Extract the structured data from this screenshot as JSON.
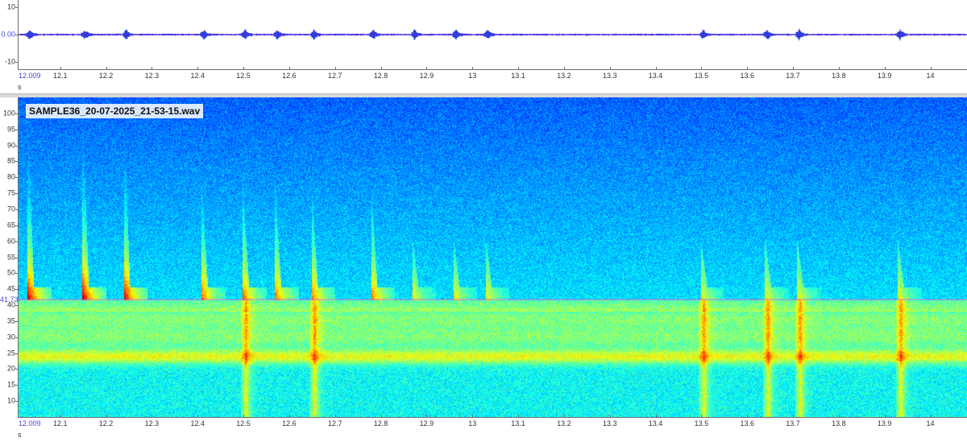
{
  "file_name": "SAMPLE36_20-07-2025_21-53-15.wav",
  "waveform": {
    "y_ticks": [
      "10",
      "0.00",
      "-10"
    ],
    "y_values": [
      10,
      0,
      -10
    ],
    "ylim": [
      -12.5,
      12.5
    ],
    "line_color": "#6a2de8",
    "zero_label_color": "#4848d8"
  },
  "time_axis": {
    "start_label": "12.009",
    "unit": "s",
    "xlim": [
      12.009,
      14.08
    ],
    "ticks": [
      {
        "t": 12.1,
        "label": "12.1"
      },
      {
        "t": 12.2,
        "label": "12.2"
      },
      {
        "t": 12.3,
        "label": "12.3"
      },
      {
        "t": 12.4,
        "label": "12.4"
      },
      {
        "t": 12.5,
        "label": "12.5"
      },
      {
        "t": 12.6,
        "label": "12.6"
      },
      {
        "t": 12.7,
        "label": "12.7"
      },
      {
        "t": 12.8,
        "label": "12.8"
      },
      {
        "t": 12.9,
        "label": "12.9"
      },
      {
        "t": 13.0,
        "label": "13"
      },
      {
        "t": 13.1,
        "label": "13.1"
      },
      {
        "t": 13.2,
        "label": "13.2"
      },
      {
        "t": 13.3,
        "label": "13.3"
      },
      {
        "t": 13.4,
        "label": "13.4"
      },
      {
        "t": 13.5,
        "label": "13.5"
      },
      {
        "t": 13.6,
        "label": "13.6"
      },
      {
        "t": 13.7,
        "label": "13.7"
      },
      {
        "t": 13.8,
        "label": "13.8"
      },
      {
        "t": 13.9,
        "label": "13.9"
      },
      {
        "t": 14.0,
        "label": "14"
      }
    ]
  },
  "spectrogram": {
    "freq_ticks": [
      "100",
      "95",
      "90",
      "85",
      "80",
      "75",
      "70",
      "65",
      "60",
      "55",
      "50",
      "45",
      "40",
      "35",
      "30",
      "25",
      "20",
      "15",
      "10"
    ],
    "freq_values": [
      100,
      95,
      90,
      85,
      80,
      75,
      70,
      65,
      60,
      55,
      50,
      45,
      40,
      35,
      30,
      25,
      20,
      15,
      10
    ],
    "flim": [
      5,
      105
    ],
    "cursor_label": "41.73",
    "cursor_value": 41.73,
    "cursor_color": "#d070d8",
    "bands_khz": [
      24,
      30,
      36
    ],
    "calls_s": [
      12.03,
      12.15,
      12.24,
      12.41,
      12.5,
      12.57,
      12.65,
      12.78,
      12.87,
      12.96,
      13.03,
      13.5,
      13.64,
      13.71,
      13.93
    ]
  }
}
